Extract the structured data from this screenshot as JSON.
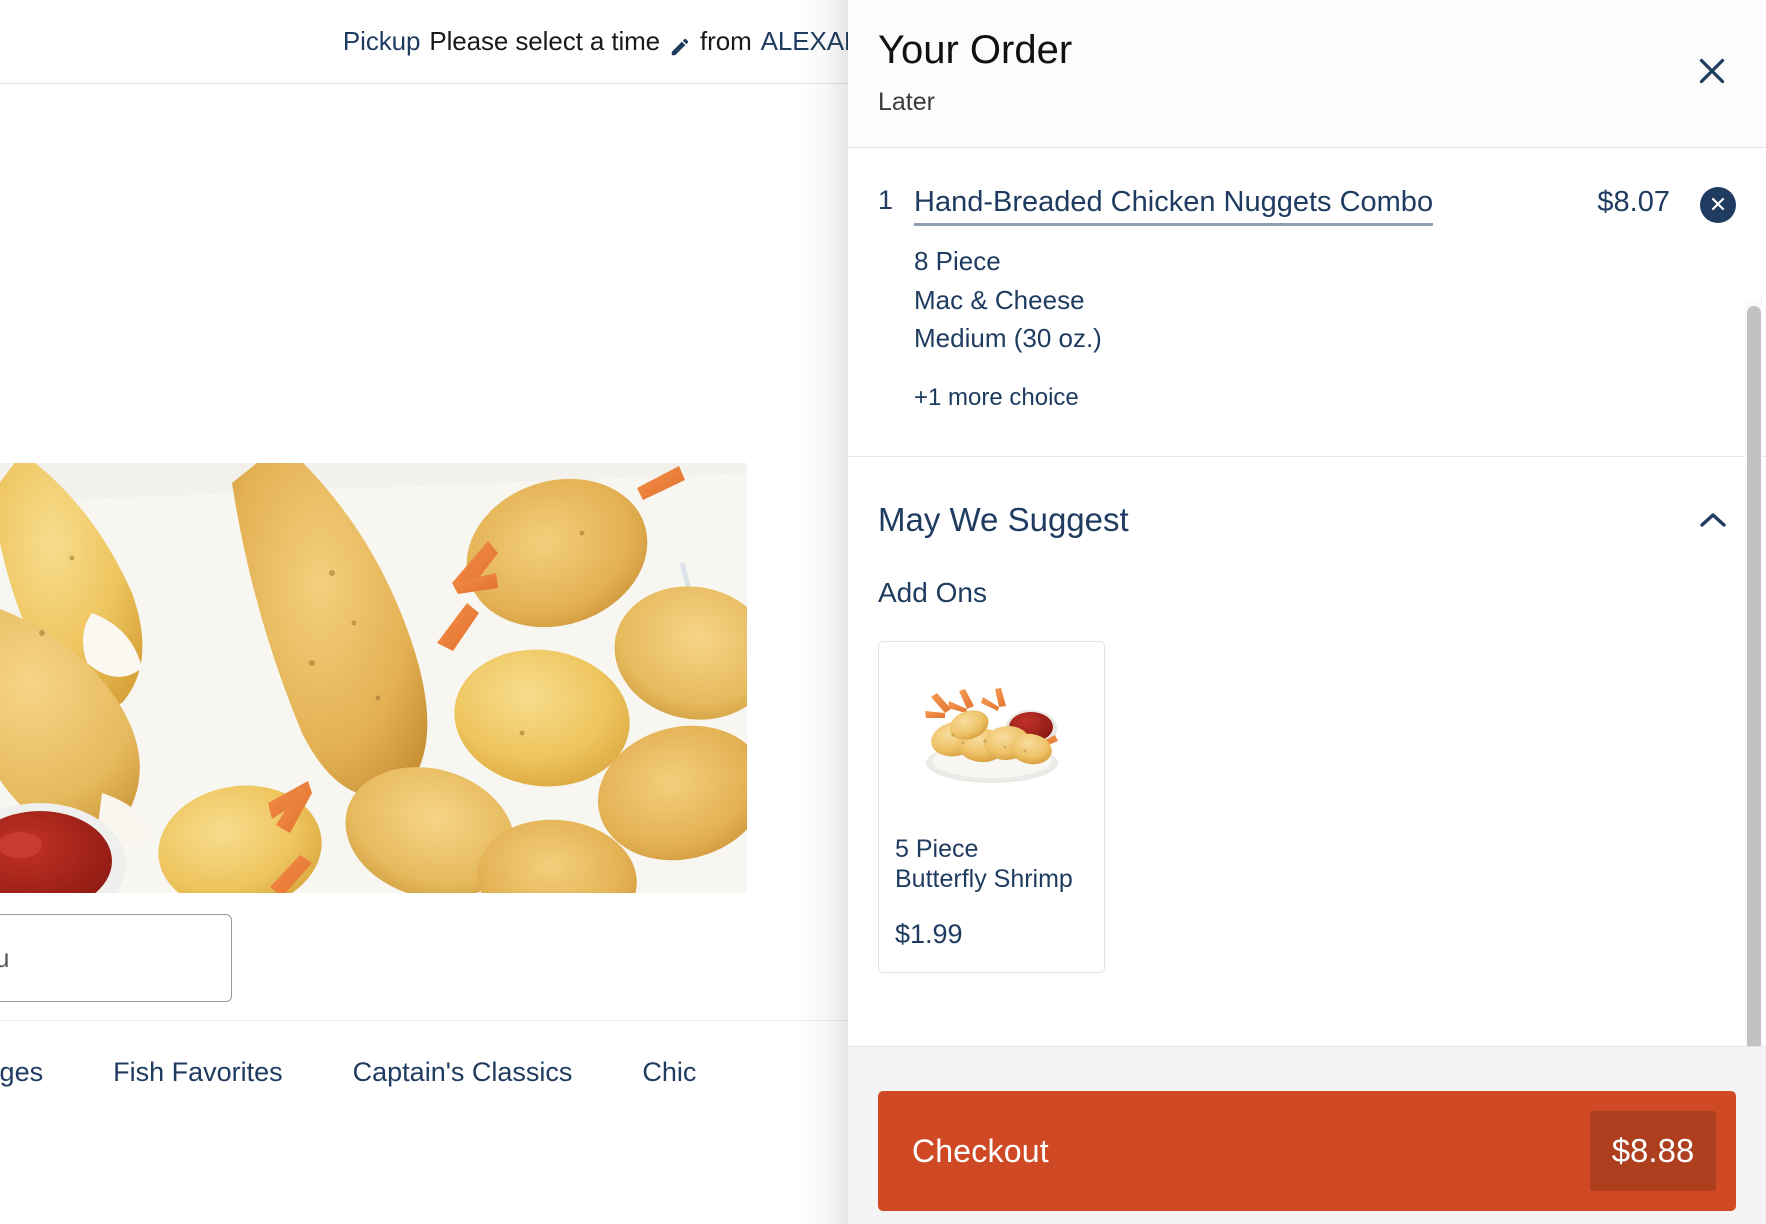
{
  "topbar": {
    "pickup_label": "Pickup",
    "time_text": "Please select a time",
    "edit_icon": "pencil-icon",
    "from_label": "from",
    "store_name": "ALEXANDER C"
  },
  "search": {
    "value": "",
    "placeholder": "the menu"
  },
  "categories": [
    {
      "label": "Beverages"
    },
    {
      "label": "Fish Favorites"
    },
    {
      "label": "Captain's Classics"
    },
    {
      "label": "Chic"
    }
  ],
  "order_panel": {
    "title": "Your Order",
    "subtitle": "Later",
    "close_icon": "close-icon",
    "items": [
      {
        "quantity": "1",
        "name": "Hand-Breaded Chicken Nuggets Combo",
        "price": "$8.07",
        "remove_icon": "remove-circle-icon",
        "options": [
          "8 Piece",
          "Mac & Cheese",
          "Medium (30 oz.)"
        ],
        "more_choices": "+1 more choice"
      }
    ],
    "suggest": {
      "title": "May We Suggest",
      "toggle_icon": "chevron-up-icon",
      "expanded": true,
      "group_label": "Add Ons",
      "cards": [
        {
          "name": "5 Piece\nButterfly Shrimp",
          "name_line1": "5 Piece",
          "name_line2": "Butterfly Shrimp",
          "price": "$1.99",
          "image": "butterfly-shrimp-photo"
        }
      ]
    },
    "footer": {
      "checkout_label": "Checkout",
      "total": "$8.88"
    }
  },
  "colors": {
    "navy": "#1f3c60",
    "accent_orange": "#cf4a24",
    "panel_bg": "#ffffff",
    "footer_bg": "#f4f4f4"
  }
}
